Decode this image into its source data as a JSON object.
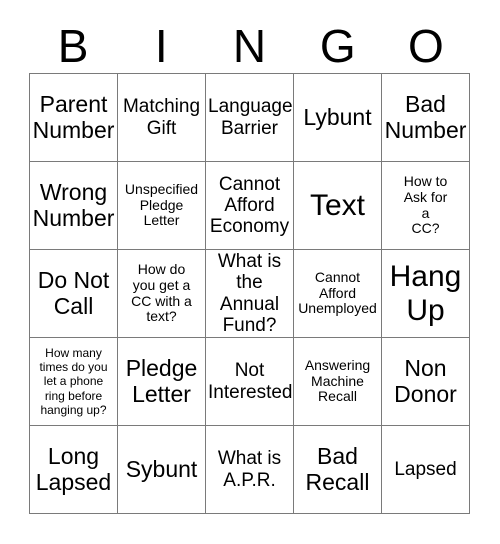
{
  "card": {
    "title": "BINGO Card",
    "header": {
      "letters": [
        "B",
        "I",
        "N",
        "G",
        "O"
      ]
    },
    "grid": {
      "columns": 5,
      "rows": 5,
      "border_color": "#7a7a7a",
      "background": "#ffffff",
      "text_color": "#000000"
    },
    "cells": [
      {
        "text": "Parent\nNumber",
        "size": "lg"
      },
      {
        "text": "Matching\nGift",
        "size": "md"
      },
      {
        "text": "Language\nBarrier",
        "size": "md"
      },
      {
        "text": "Lybunt",
        "size": "lg"
      },
      {
        "text": "Bad\nNumber",
        "size": "lg"
      },
      {
        "text": "Wrong\nNumber",
        "size": "lg"
      },
      {
        "text": "Unspecified\nPledge\nLetter",
        "size": "sm"
      },
      {
        "text": "Cannot\nAfford\nEconomy",
        "size": "md"
      },
      {
        "text": "Text",
        "size": "xl"
      },
      {
        "text": "How to\nAsk for\na\nCC?",
        "size": "sm"
      },
      {
        "text": "Do Not\nCall",
        "size": "lg"
      },
      {
        "text": "How do\nyou get a\nCC with a\ntext?",
        "size": "sm"
      },
      {
        "text": "What is\nthe\nAnnual\nFund?",
        "size": "md"
      },
      {
        "text": "Cannot\nAfford\nUnemployed",
        "size": "sm"
      },
      {
        "text": "Hang\nUp",
        "size": "xl"
      },
      {
        "text": "How many\ntimes do you\nlet a phone\nring before\nhanging up?",
        "size": "xs"
      },
      {
        "text": "Pledge\nLetter",
        "size": "lg"
      },
      {
        "text": "Not\nInterested",
        "size": "md"
      },
      {
        "text": "Answering\nMachine\nRecall",
        "size": "sm"
      },
      {
        "text": "Non\nDonor",
        "size": "lg"
      },
      {
        "text": "Long\nLapsed",
        "size": "lg"
      },
      {
        "text": "Sybunt",
        "size": "lg"
      },
      {
        "text": "What is\nA.P.R.",
        "size": "md"
      },
      {
        "text": "Bad\nRecall",
        "size": "lg"
      },
      {
        "text": "Lapsed",
        "size": "md"
      }
    ]
  }
}
